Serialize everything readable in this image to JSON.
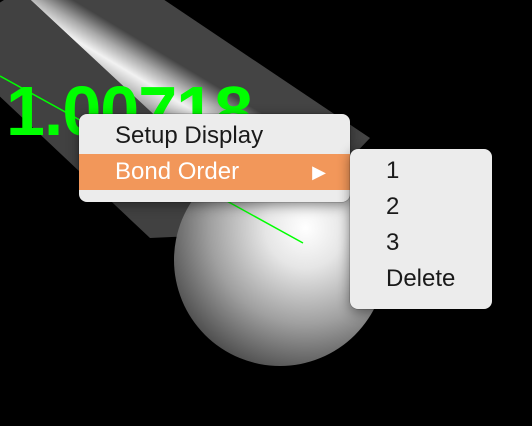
{
  "viewer": {
    "distance_label": "1.00718",
    "label_color": "#00ff00",
    "background_color": "#000000"
  },
  "context_menu": {
    "items": [
      {
        "label": "Setup Display",
        "active": false
      },
      {
        "label": "Bond Order",
        "active": true,
        "has_submenu": true,
        "arrow": "▶"
      }
    ],
    "highlight_color": "#f2975a"
  },
  "submenu": {
    "items": [
      {
        "label": "1"
      },
      {
        "label": "2"
      },
      {
        "label": "3"
      },
      {
        "label": "Delete"
      }
    ]
  }
}
